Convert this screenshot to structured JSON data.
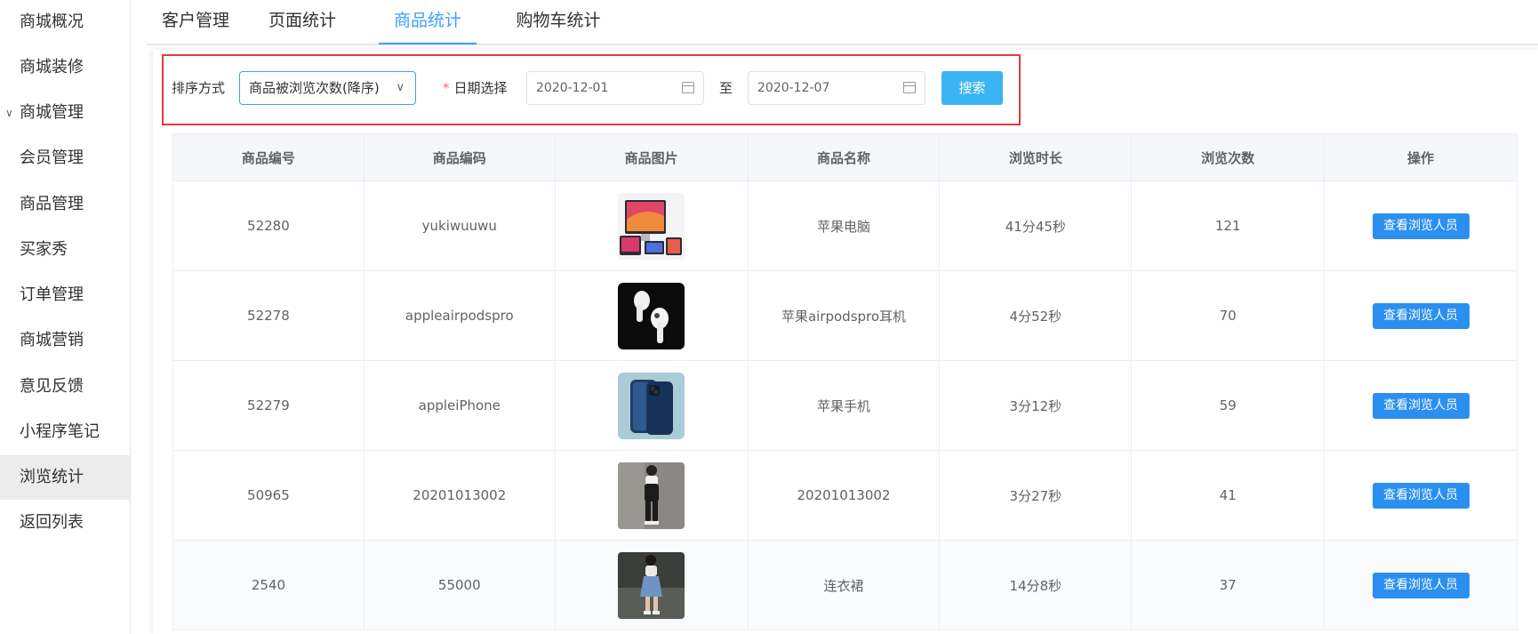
{
  "sidebar": {
    "items": [
      {
        "label": "商城概况"
      },
      {
        "label": "商城装修"
      },
      {
        "label": "商城管理",
        "expanded": true
      },
      {
        "label": "会员管理"
      },
      {
        "label": "商品管理"
      },
      {
        "label": "买家秀"
      },
      {
        "label": "订单管理"
      },
      {
        "label": "商城营销"
      },
      {
        "label": "意见反馈"
      },
      {
        "label": "小程序笔记"
      },
      {
        "label": "浏览统计",
        "active": true
      },
      {
        "label": "返回列表"
      }
    ]
  },
  "tabs": [
    {
      "label": "客户管理"
    },
    {
      "label": "页面统计"
    },
    {
      "label": "商品统计",
      "active": true
    },
    {
      "label": "购物车统计"
    }
  ],
  "filter": {
    "sort_label": "排序方式",
    "sort_value": "商品被浏览次数(降序)",
    "date_label": "日期选择",
    "start_date": "2020-12-01",
    "to_label": "至",
    "end_date": "2020-12-07",
    "search_label": "搜索"
  },
  "table": {
    "headers": [
      "商品编号",
      "商品编码",
      "商品图片",
      "商品名称",
      "浏览时长",
      "浏览次数",
      "操作"
    ],
    "rows": [
      {
        "id": "52280",
        "code": "yukiwuuwu",
        "image": "macbook-devices-image",
        "name": "苹果电脑",
        "duration": "41分45秒",
        "views": "121",
        "action": "查看浏览人员"
      },
      {
        "id": "52278",
        "code": "appleairpodspro",
        "image": "airpods-image",
        "name": "苹果airpodspro耳机",
        "duration": "4分52秒",
        "views": "70",
        "action": "查看浏览人员"
      },
      {
        "id": "52279",
        "code": "appleiPhone",
        "image": "iphone-image",
        "name": "苹果手机",
        "duration": "3分12秒",
        "views": "59",
        "action": "查看浏览人员"
      },
      {
        "id": "50965",
        "code": "20201013002",
        "image": "overalls-model-image",
        "name": "20201013002",
        "duration": "3分27秒",
        "views": "41",
        "action": "查看浏览人员"
      },
      {
        "id": "2540",
        "code": "55000",
        "image": "denim-dress-model-image",
        "name": "连衣裙",
        "duration": "14分8秒",
        "views": "37",
        "action": "查看浏览人员"
      }
    ]
  },
  "colors": {
    "accent": "#409eff",
    "search_button": "#3ab4f2",
    "action_button": "#2b8ff0",
    "highlight_border": "#e5383b",
    "required_star": "#f56c6c"
  }
}
